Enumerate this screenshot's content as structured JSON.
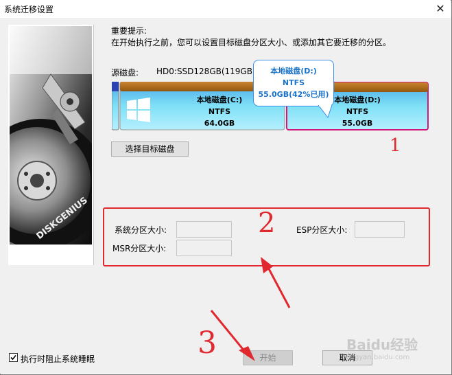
{
  "window": {
    "title": "系统迁移设置"
  },
  "hint": {
    "heading": "重要提示:",
    "text": "在开始执行之前，您可以设置目标磁盘分区大小、或添加其它要迁移的分区。"
  },
  "source_disk": {
    "label": "源磁盘:",
    "value": "HD0:SSD128GB(119GB)",
    "partitions": [
      {
        "name": "本地磁盘(C:)",
        "fs": "NTFS",
        "size": "64.0GB"
      },
      {
        "name": "本地磁盘(D:)",
        "fs": "NTFS",
        "size": "55.0GB"
      }
    ]
  },
  "tooltip": {
    "name": "本地磁盘(D:)",
    "fs": "NTFS",
    "detail": "55.0GB(42%已用)"
  },
  "buttons": {
    "select_target": "选择目标磁盘",
    "start": "开始",
    "cancel": "取消"
  },
  "fields": {
    "system_size_label": "系统分区大小:",
    "esp_size_label": "ESP分区大小:",
    "msr_size_label": "MSR分区大小:"
  },
  "checkbox": {
    "label": "执行时阻止系统睡眠",
    "checked": true
  },
  "brand": {
    "logo_text": "DISKGENIUS"
  },
  "annotations": {
    "n1": "1",
    "n2": "2",
    "n3": "3"
  },
  "watermark": {
    "text": "Baidu经验",
    "sub": "jingyan.baidu.com"
  },
  "colors": {
    "accent": "#1a73c9",
    "annotation": "#e0292f",
    "partition_top": "#b66a1a",
    "partition_fill": "#6fd6f4"
  },
  "icons": {
    "os_logo": "windows-icon",
    "close": "close-icon",
    "checkbox": "checkbox-icon"
  }
}
